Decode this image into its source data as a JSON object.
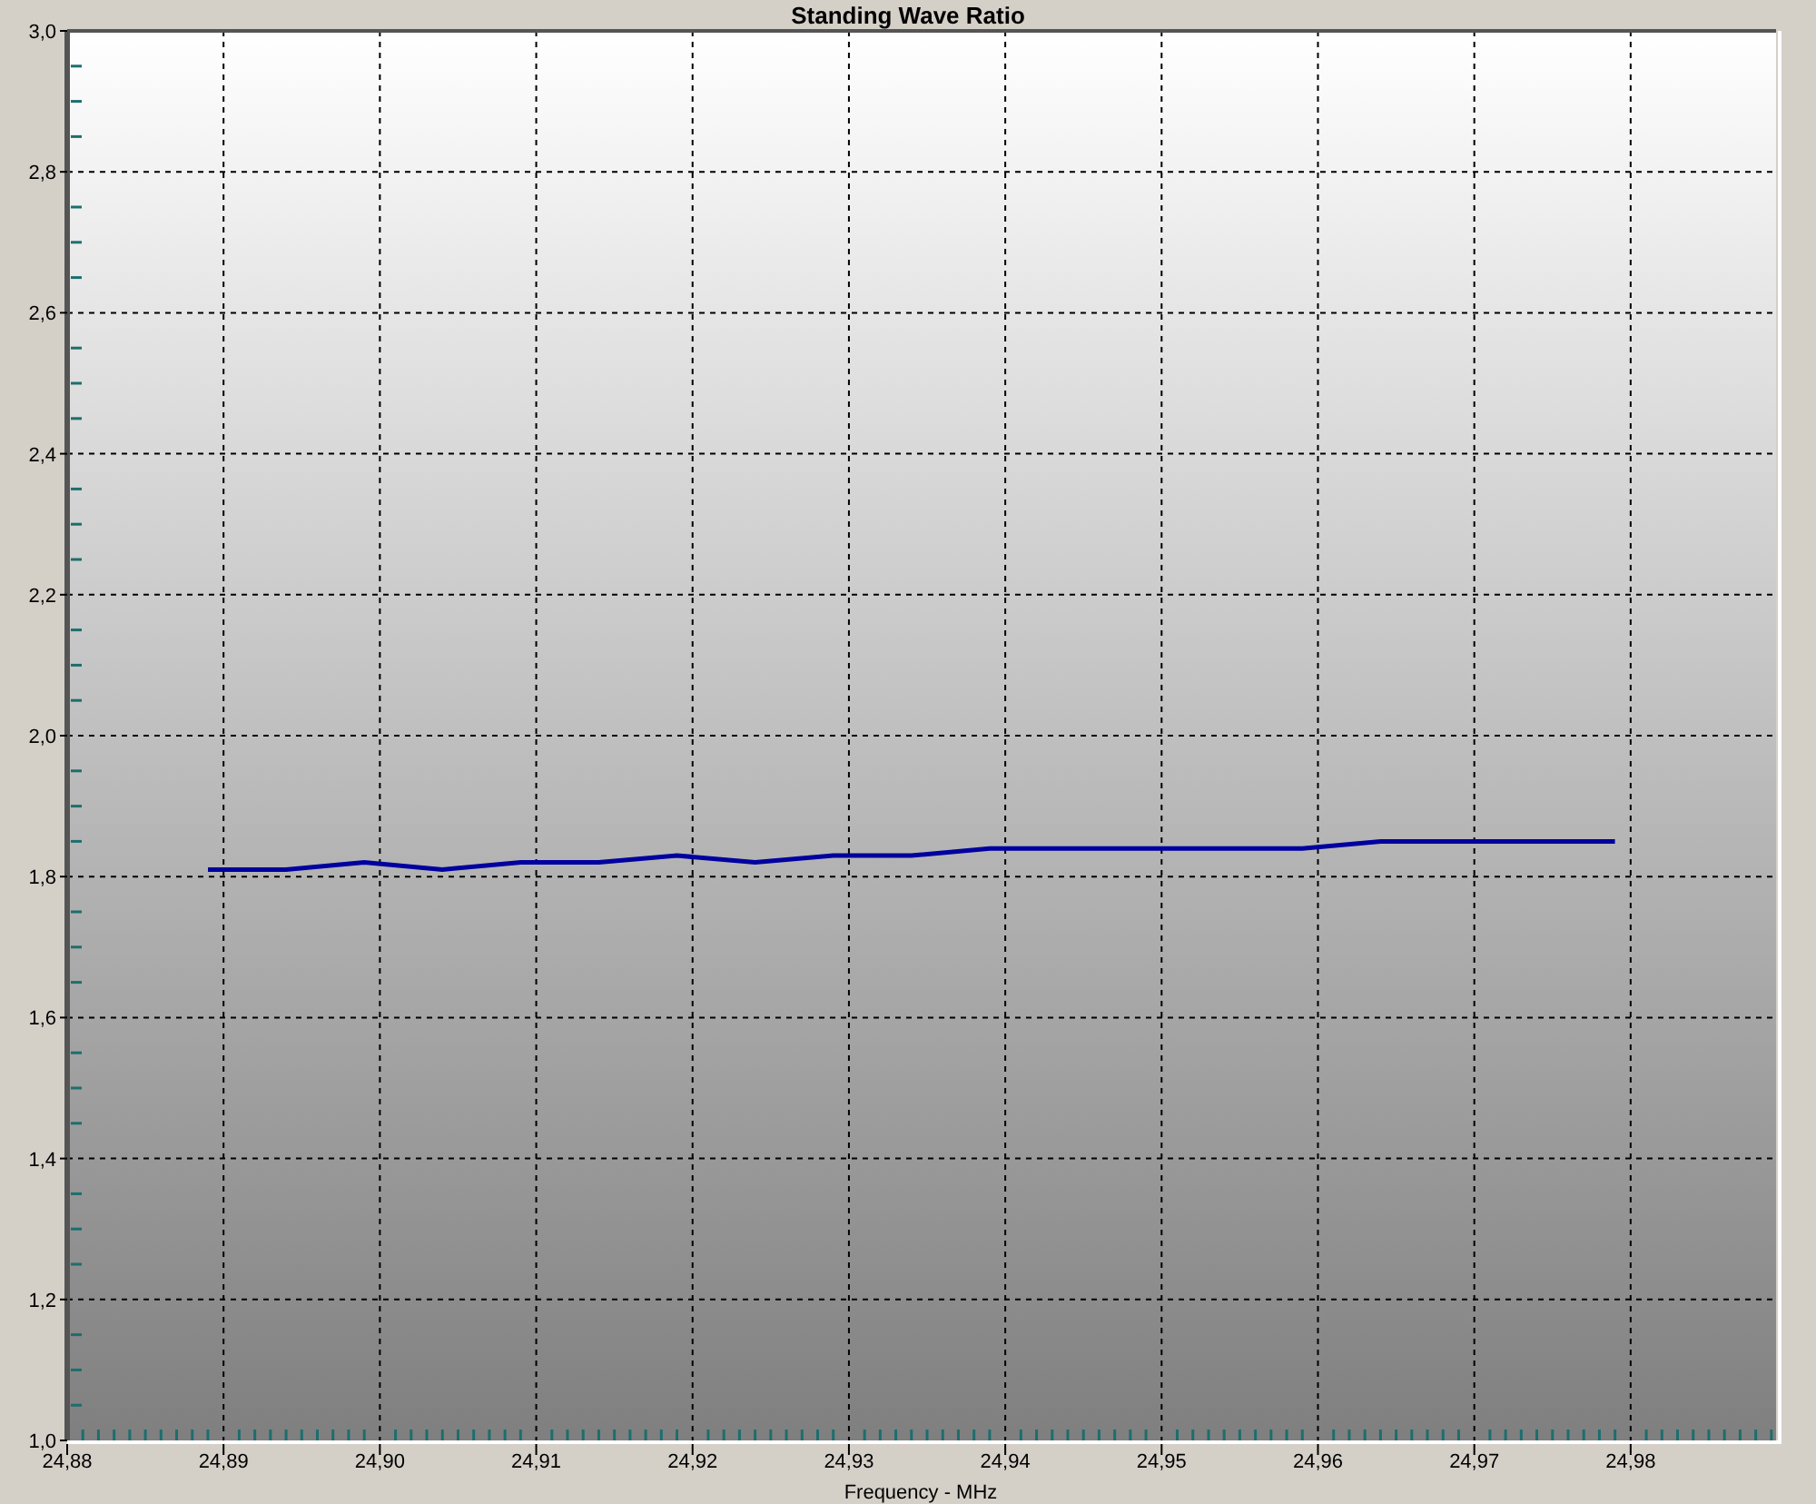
{
  "chart": {
    "chart_data": {
      "type": "line",
      "title": "Standing Wave Ratio",
      "xlabel": "Frequency - MHz",
      "x": [
        24.889,
        24.894,
        24.899,
        24.904,
        24.909,
        24.914,
        24.919,
        24.924,
        24.929,
        24.934,
        24.939,
        24.944,
        24.949,
        24.954,
        24.959,
        24.964,
        24.969,
        24.974,
        24.979
      ],
      "series": [
        {
          "color": "#0000a0",
          "values": [
            1.81,
            1.81,
            1.82,
            1.81,
            1.82,
            1.82,
            1.83,
            1.82,
            1.83,
            1.83,
            1.84,
            1.84,
            1.84,
            1.84,
            1.84,
            1.85,
            1.85,
            1.85,
            1.85
          ]
        }
      ],
      "grid": true,
      "xlim": [
        24.88,
        24.9893
      ],
      "ylim": [
        1.0,
        3.0
      ],
      "xticks": [
        {
          "value": 24.88,
          "label": "24,88"
        },
        {
          "value": 24.89,
          "label": "24,89"
        },
        {
          "value": 24.9,
          "label": "24,90"
        },
        {
          "value": 24.91,
          "label": "24,91"
        },
        {
          "value": 24.92,
          "label": "24,92"
        },
        {
          "value": 24.93,
          "label": "24,93"
        },
        {
          "value": 24.94,
          "label": "24,94"
        },
        {
          "value": 24.95,
          "label": "24,95"
        },
        {
          "value": 24.96,
          "label": "24,96"
        },
        {
          "value": 24.97,
          "label": "24,97"
        },
        {
          "value": 24.98,
          "label": "24,98"
        }
      ],
      "yticks": [
        {
          "value": 1.0,
          "label": "1,0"
        },
        {
          "value": 1.2,
          "label": "1,2"
        },
        {
          "value": 1.4,
          "label": "1,4"
        },
        {
          "value": 1.6,
          "label": "1,6"
        },
        {
          "value": 1.8,
          "label": "1,8"
        },
        {
          "value": 2.0,
          "label": "2,0"
        },
        {
          "value": 2.2,
          "label": "2,2"
        },
        {
          "value": 2.4,
          "label": "2,4"
        },
        {
          "value": 2.6,
          "label": "2,6"
        },
        {
          "value": 2.8,
          "label": "2,8"
        },
        {
          "value": 3.0,
          "label": "3,0"
        }
      ]
    }
  }
}
